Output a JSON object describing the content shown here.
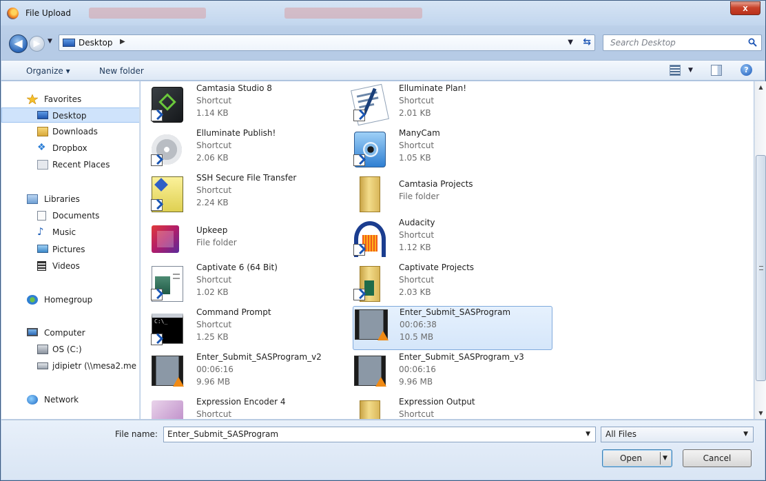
{
  "window": {
    "title": "File Upload",
    "close_label": "x",
    "accent": "#c8432b"
  },
  "nav": {
    "back_glyph": "◀",
    "forward_glyph": "▶",
    "address": "Desktop",
    "search_placeholder": "Search Desktop"
  },
  "toolbar": {
    "organize": "Organize ▾",
    "new_folder": "New folder",
    "help": "?"
  },
  "sidebar": {
    "items": [
      {
        "label": "Favorites",
        "icon": "star-icon"
      },
      {
        "label": "Desktop",
        "icon": "desktop-icon"
      },
      {
        "label": "Downloads",
        "icon": "downloads-folder-icon"
      },
      {
        "label": "Dropbox",
        "icon": "dropbox-icon"
      },
      {
        "label": "Recent Places",
        "icon": "recent-places-icon"
      },
      {
        "label": "Libraries",
        "icon": "libraries-icon"
      },
      {
        "label": "Documents",
        "icon": "documents-icon"
      },
      {
        "label": "Music",
        "icon": "music-icon"
      },
      {
        "label": "Pictures",
        "icon": "pictures-icon"
      },
      {
        "label": "Videos",
        "icon": "videos-icon"
      },
      {
        "label": "Homegroup",
        "icon": "homegroup-icon"
      },
      {
        "label": "Computer",
        "icon": "computer-icon"
      },
      {
        "label": "OS (C:)",
        "icon": "drive-icon"
      },
      {
        "label": "jdipietr (\\\\mesa2.me",
        "icon": "network-drive-icon"
      },
      {
        "label": "Network",
        "icon": "network-icon"
      }
    ]
  },
  "files": [
    {
      "name": "Camtasia Studio 8",
      "line2": "Shortcut",
      "line3": "1.14 KB",
      "icon": "camtasia-icon"
    },
    {
      "name": "Elluminate Plan!",
      "line2": "Shortcut",
      "line3": "2.01 KB",
      "icon": "elluminate-plan-icon"
    },
    {
      "name": "Elluminate Publish!",
      "line2": "Shortcut",
      "line3": "2.06 KB",
      "icon": "elluminate-publish-icon"
    },
    {
      "name": "ManyCam",
      "line2": "Shortcut",
      "line3": "1.05 KB",
      "icon": "manycam-icon"
    },
    {
      "name": "SSH Secure File Transfer",
      "line2": "Shortcut",
      "line3": "2.24 KB",
      "icon": "ssh-icon"
    },
    {
      "name": "Camtasia Projects",
      "line2": "File folder",
      "line3": "",
      "icon": "folder-icon"
    },
    {
      "name": "Upkeep",
      "line2": "File folder",
      "line3": "",
      "icon": "upkeep-icon"
    },
    {
      "name": "Audacity",
      "line2": "Shortcut",
      "line3": "1.12 KB",
      "icon": "audacity-icon"
    },
    {
      "name": "Captivate 6 (64 Bit)",
      "line2": "Shortcut",
      "line3": "1.02 KB",
      "icon": "captivate-icon"
    },
    {
      "name": "Captivate Projects",
      "line2": "Shortcut",
      "line3": "2.03 KB",
      "icon": "folder-shortcut-icon"
    },
    {
      "name": "Command Prompt",
      "line2": "Shortcut",
      "line3": "1.25 KB",
      "icon": "cmd-icon"
    },
    {
      "name": "Enter_Submit_SASProgram",
      "line2": "00:06:38",
      "line3": "10.5 MB",
      "icon": "video-icon"
    },
    {
      "name": "Enter_Submit_SASProgram_v2",
      "line2": "00:06:16",
      "line3": "9.96 MB",
      "icon": "video-icon"
    },
    {
      "name": "Enter_Submit_SASProgram_v3",
      "line2": "00:06:16",
      "line3": "9.96 MB",
      "icon": "video-icon"
    },
    {
      "name": "Expression Encoder 4",
      "line2": "Shortcut",
      "line3": "",
      "icon": "expression-icon"
    },
    {
      "name": "Expression Output",
      "line2": "Shortcut",
      "line3": "",
      "icon": "folder-icon"
    }
  ],
  "footer": {
    "filename_label": "File name:",
    "filename_value": "Enter_Submit_SASProgram",
    "filter_value": "All Files",
    "open": "Open",
    "cancel": "Cancel"
  }
}
